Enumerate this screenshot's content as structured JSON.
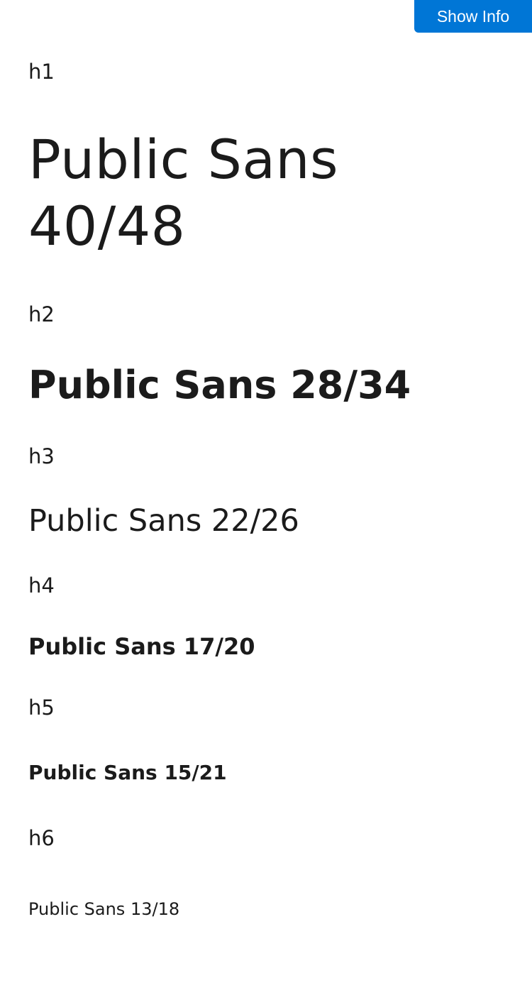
{
  "button": {
    "label": "Show Info"
  },
  "specimens": [
    {
      "tag": "h1",
      "sample_line1": "Public Sans",
      "sample_line2": "40/48"
    },
    {
      "tag": "h2",
      "sample": "Public Sans 28/34"
    },
    {
      "tag": "h3",
      "sample": "Public Sans 22/26"
    },
    {
      "tag": "h4",
      "sample": "Public Sans 17/20"
    },
    {
      "tag": "h5",
      "sample": "Public Sans 15/21"
    },
    {
      "tag": "h6",
      "sample": "Public Sans 13/18"
    }
  ],
  "colors": {
    "button_bg": "#0076d6",
    "button_text": "#ffffff",
    "text": "#1b1b1b",
    "background": "#ffffff"
  }
}
